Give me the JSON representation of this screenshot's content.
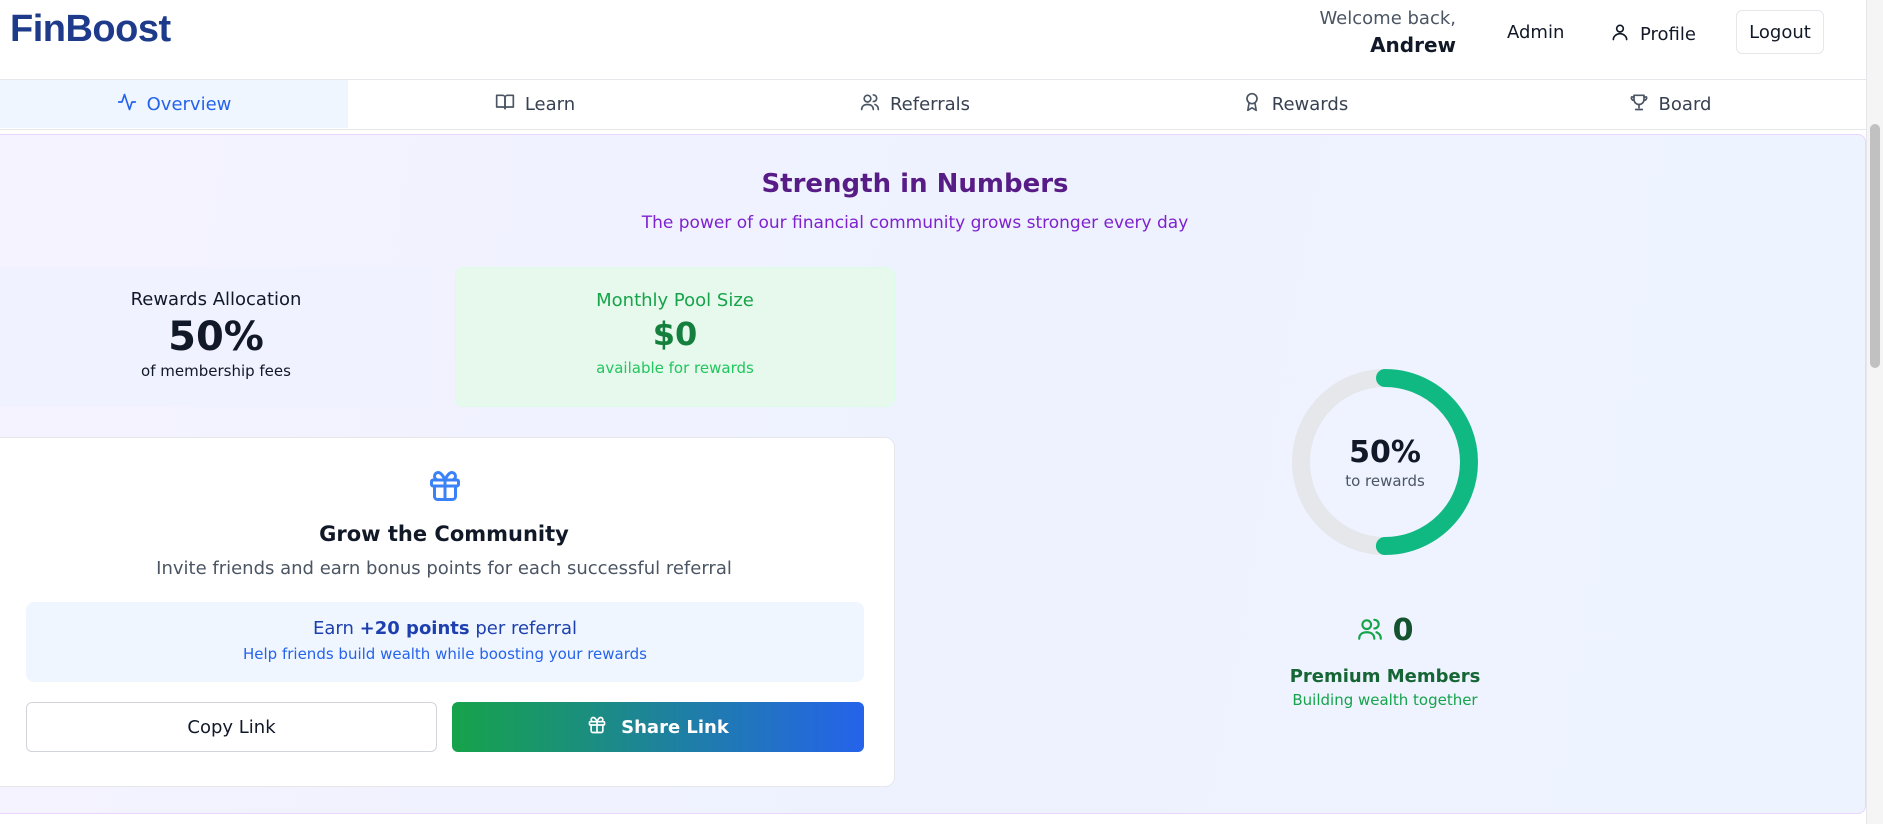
{
  "header": {
    "logo": "FinBoost",
    "welcome_line": "Welcome back,",
    "user_name": "Andrew",
    "admin_label": "Admin",
    "profile_label": "Profile",
    "logout_label": "Logout"
  },
  "tabs": [
    {
      "label": "Overview",
      "icon": "activity-icon",
      "active": true
    },
    {
      "label": "Learn",
      "icon": "book-icon",
      "active": false
    },
    {
      "label": "Referrals",
      "icon": "users-icon",
      "active": false
    },
    {
      "label": "Rewards",
      "icon": "award-icon",
      "active": false
    },
    {
      "label": "Board",
      "icon": "trophy-icon",
      "active": false
    }
  ],
  "section": {
    "title": "Strength in Numbers",
    "subtitle": "The power of our financial community grows stronger every day"
  },
  "allocation": {
    "title": "Rewards Allocation",
    "value": "50%",
    "subtitle": "of membership fees"
  },
  "pool": {
    "title": "Monthly Pool Size",
    "value": "$0",
    "subtitle": "available for rewards"
  },
  "grow": {
    "icon": "gift-icon",
    "title": "Grow the Community",
    "description": "Invite friends and earn bonus points for each successful referral",
    "earn_prefix": "Earn",
    "earn_points": "+20 points",
    "earn_suffix": "per referral",
    "earn_sub": "Help friends build wealth while boosting your rewards",
    "copy_label": "Copy Link",
    "share_label": "Share Link"
  },
  "donut": {
    "value_text": "50%",
    "label": "to rewards",
    "fraction": 0.5,
    "track_color": "#e5e7eb",
    "fill_color": "#10b981"
  },
  "members": {
    "icon": "users-icon",
    "count": "0",
    "label": "Premium Members",
    "sub": "Building wealth together"
  },
  "colors": {
    "brand": "#1e3a8a",
    "accent": "#2563eb",
    "title_purple": "#581c87",
    "green": "#16a34a"
  }
}
